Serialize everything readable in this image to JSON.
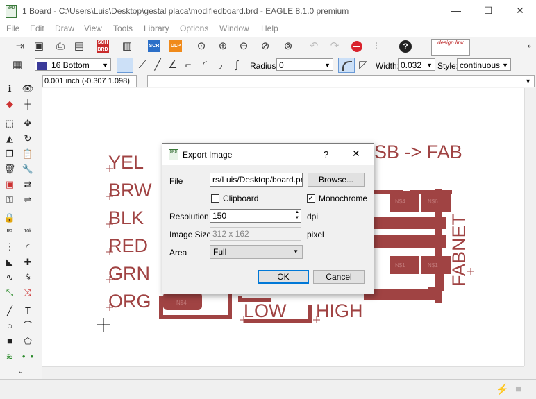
{
  "window": {
    "title": "1 Board - C:\\Users\\Luis\\Desktop\\gestal placa\\modifiedboard.brd - EAGLE 8.1.0 premium",
    "app_icon": "BRD",
    "minimize": "—",
    "maximize": "☐",
    "close": "✕"
  },
  "menu": [
    "File",
    "Edit",
    "Draw",
    "View",
    "Tools",
    "Library",
    "Options",
    "Window",
    "Help"
  ],
  "toolbar2": {
    "layer_value": "16 Bottom",
    "layer_color": "#3b3b9a",
    "radius_label": "Radius:",
    "radius_value": "0",
    "width_label": "Width:",
    "width_value": "0.032",
    "style_label": "Style:",
    "style_value": "continuous"
  },
  "toolbar1": {
    "sch_label": "SCH",
    "brd_label": "BRD",
    "scr_label": "SCR",
    "ulp_label": "ULP",
    "design_link_label": "design link"
  },
  "coordbar": {
    "coordinate": "0.001 inch (-0.307 1.098)",
    "command_value": ""
  },
  "canvas": {
    "labels": {
      "yel": "YEL",
      "brw": "BRW",
      "blk": "BLK",
      "red": "RED",
      "grn": "GRN",
      "org": "ORG",
      "low": "LOW",
      "high": "HIGH",
      "fabnet": "FABNET",
      "usb_fab": "SB -> FAB"
    },
    "pads": [
      "N$4",
      "N$6",
      "N$1",
      "N$1",
      "N$4"
    ],
    "copper_color": "#a04343"
  },
  "dialog": {
    "title": "Export Image",
    "help": "?",
    "close": "✕",
    "file_label": "File",
    "file_value": "rs/Luis/Desktop/board.png",
    "browse_button": "Browse...",
    "clipboard_label": "Clipboard",
    "clipboard_checked": false,
    "monochrome_label": "Monochrome",
    "monochrome_checked": true,
    "resolution_label": "Resolution",
    "resolution_value": "150",
    "dpi_label": "dpi",
    "image_size_label": "Image Size",
    "image_size_value": "312 x 162",
    "pixel_label": "pixel",
    "area_label": "Area",
    "area_value": "Full",
    "ok_button": "OK",
    "cancel_button": "Cancel"
  }
}
